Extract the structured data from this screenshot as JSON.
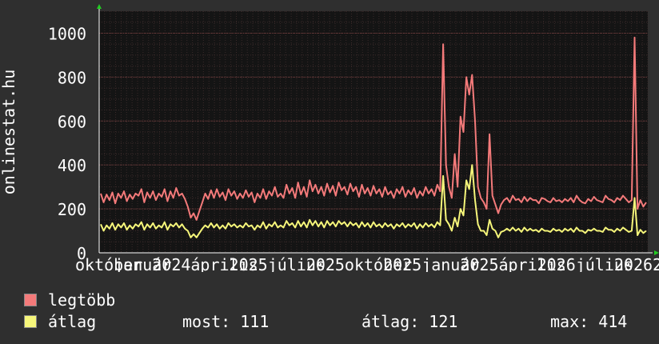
{
  "colors": {
    "background": "#2f2f2f",
    "plot_background": "#141414",
    "grid_major": "#7a4040",
    "grid_minor": "#3a2a2a",
    "legtobb": "#f47a7a",
    "atlag": "#f6f67a",
    "axis_arrow": "#22cc22"
  },
  "legend": {
    "items": [
      {
        "label": "legtöbb",
        "color": "#f47a7a"
      },
      {
        "label": "átlag",
        "color": "#f6f67a"
      }
    ],
    "stats": {
      "most": "most: 111",
      "atlag": "átlag: 121",
      "max": "max: 414"
    }
  },
  "chart_data": {
    "type": "line",
    "ylabel": "onlinestat.hu",
    "ylim": [
      0,
      1100
    ],
    "y_ticks": [
      0,
      200,
      400,
      600,
      800,
      1000
    ],
    "x_labels": [
      "október",
      "január",
      "2024",
      "április",
      "2025",
      "július",
      "2025",
      "október",
      "2025",
      "január",
      "2025",
      "április",
      "2026",
      "július",
      "2026",
      "2026"
    ],
    "grid": true,
    "series": [
      {
        "name": "legtöbb",
        "color": "#f47a7a",
        "values": [
          270,
          230,
          265,
          240,
          275,
          225,
          270,
          250,
          280,
          235,
          265,
          245,
          270,
          260,
          290,
          230,
          275,
          250,
          280,
          240,
          270,
          255,
          290,
          235,
          280,
          250,
          295,
          260,
          270,
          245,
          210,
          160,
          180,
          150,
          190,
          230,
          270,
          245,
          285,
          250,
          290,
          255,
          275,
          240,
          290,
          260,
          280,
          245,
          270,
          250,
          285,
          255,
          275,
          230,
          270,
          250,
          290,
          245,
          280,
          260,
          300,
          255,
          270,
          250,
          310,
          270,
          295,
          250,
          320,
          265,
          300,
          255,
          330,
          280,
          310,
          270,
          300,
          260,
          315,
          275,
          305,
          260,
          320,
          285,
          300,
          265,
          315,
          280,
          300,
          255,
          310,
          270,
          295,
          260,
          305,
          270,
          290,
          255,
          300,
          265,
          280,
          250,
          290,
          270,
          300,
          255,
          285,
          265,
          295,
          250,
          280,
          260,
          300,
          270,
          290,
          260,
          310,
          280,
          950,
          400,
          300,
          250,
          450,
          300,
          620,
          550,
          800,
          720,
          810,
          600,
          300,
          250,
          230,
          200,
          540,
          260,
          220,
          180,
          220,
          240,
          250,
          230,
          260,
          240,
          245,
          230,
          255,
          235,
          250,
          240,
          240,
          225,
          250,
          245,
          235,
          230,
          250,
          235,
          240,
          230,
          245,
          235,
          250,
          230,
          260,
          240,
          230,
          225,
          245,
          235,
          255,
          240,
          235,
          230,
          260,
          245,
          240,
          230,
          250,
          240,
          260,
          245,
          230,
          240,
          980,
          200,
          240,
          210,
          230
        ]
      },
      {
        "name": "átlag",
        "color": "#f6f67a",
        "values": [
          130,
          100,
          125,
          110,
          135,
          105,
          130,
          115,
          135,
          105,
          125,
          110,
          130,
          120,
          140,
          105,
          130,
          115,
          135,
          110,
          125,
          115,
          140,
          105,
          130,
          120,
          135,
          115,
          130,
          110,
          100,
          70,
          85,
          70,
          90,
          110,
          125,
          115,
          135,
          115,
          130,
          110,
          125,
          110,
          135,
          120,
          130,
          115,
          125,
          115,
          135,
          120,
          125,
          105,
          125,
          115,
          140,
          110,
          130,
          120,
          140,
          115,
          125,
          115,
          145,
          125,
          135,
          115,
          145,
          120,
          140,
          115,
          150,
          125,
          145,
          120,
          140,
          115,
          145,
          125,
          140,
          120,
          145,
          130,
          140,
          120,
          140,
          125,
          135,
          115,
          140,
          120,
          135,
          115,
          140,
          120,
          130,
          115,
          135,
          120,
          130,
          110,
          130,
          120,
          135,
          115,
          130,
          120,
          135,
          110,
          130,
          115,
          135,
          120,
          130,
          115,
          140,
          125,
          350,
          150,
          130,
          100,
          160,
          120,
          200,
          170,
          330,
          290,
          400,
          240,
          130,
          100,
          100,
          80,
          150,
          110,
          100,
          70,
          95,
          100,
          110,
          100,
          115,
          100,
          110,
          95,
          115,
          100,
          110,
          100,
          105,
          95,
          110,
          100,
          100,
          95,
          110,
          100,
          105,
          95,
          110,
          100,
          110,
          95,
          115,
          100,
          100,
          90,
          105,
          100,
          110,
          100,
          100,
          95,
          115,
          105,
          105,
          95,
          110,
          100,
          115,
          105,
          95,
          100,
          250,
          80,
          105,
          90,
          100
        ]
      }
    ]
  }
}
